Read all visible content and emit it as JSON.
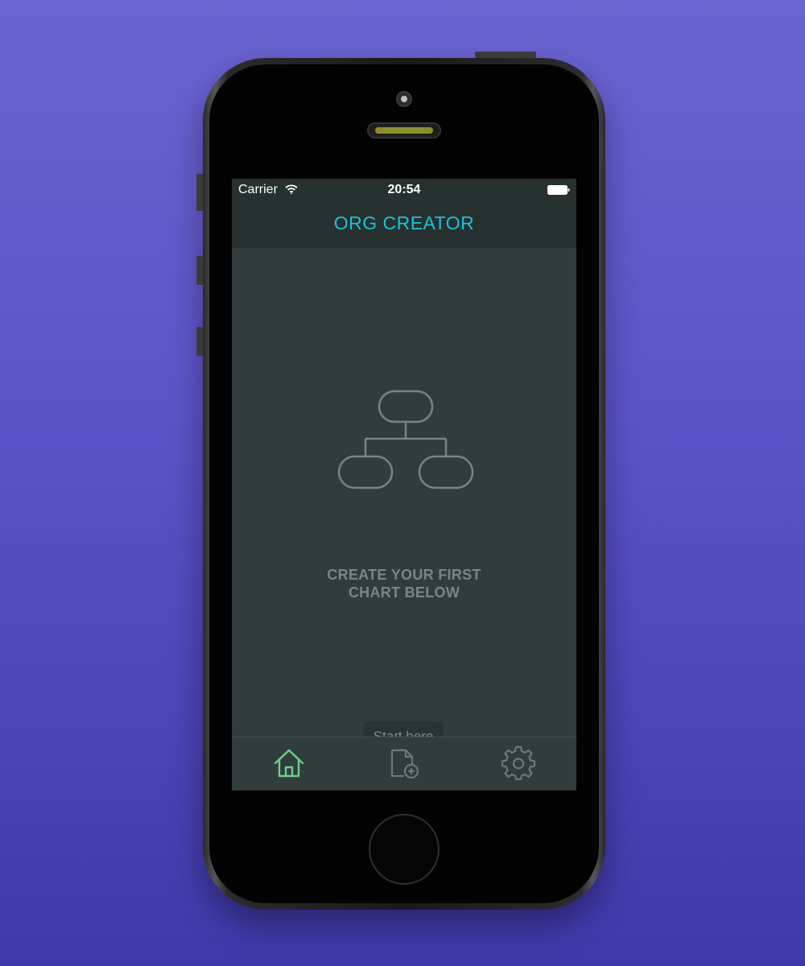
{
  "status_bar": {
    "carrier": "Carrier",
    "time": "20:54",
    "wifi_icon": "wifi-icon",
    "battery_icon": "battery-icon"
  },
  "nav": {
    "title": "ORG CREATOR"
  },
  "empty_state": {
    "icon": "org-chart-icon",
    "message_line1": "CREATE YOUR FIRST",
    "message_line2": "CHART BELOW"
  },
  "hint": {
    "label": "Start here"
  },
  "tab_bar": {
    "tabs": [
      {
        "icon": "home-icon",
        "state": "selected"
      },
      {
        "icon": "new-document-icon",
        "state": "normal"
      },
      {
        "icon": "gear-icon",
        "state": "normal"
      }
    ]
  },
  "colors": {
    "background_top": "#6a63d0",
    "background_bottom": "#3f38aa",
    "accent": "#1ec2d8",
    "selected_tab": "#6fcf8a",
    "screen_bg": "#313d3c",
    "bar_bg": "#263130"
  }
}
